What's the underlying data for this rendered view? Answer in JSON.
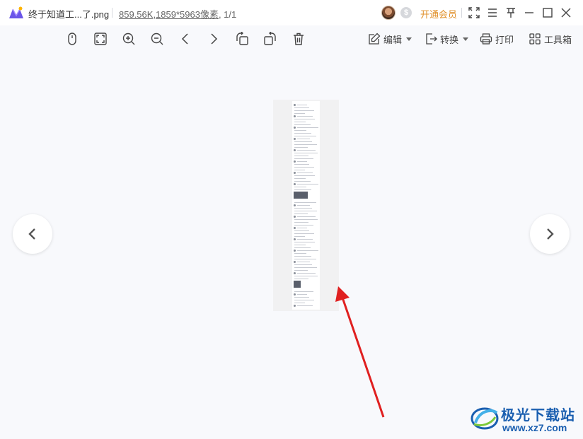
{
  "titlebar": {
    "file_name": "终于知道工...了.png",
    "file_size": "859.56K",
    "dimensions": ",1859*5963像素",
    "page_count": ", 1/1",
    "vip_label": "开通会员",
    "coin_symbol": "$"
  },
  "toolbar": {
    "edit_label": "编辑",
    "convert_label": "转换",
    "print_label": "打印",
    "toolbox_label": "工具箱"
  },
  "watermark": {
    "title": "极光下载站",
    "url": "www.xz7.com"
  },
  "colors": {
    "vip": "#e0902a",
    "watermark": "#1b5fb0",
    "arrow": "#e02020",
    "background": "#f8f9fc"
  }
}
